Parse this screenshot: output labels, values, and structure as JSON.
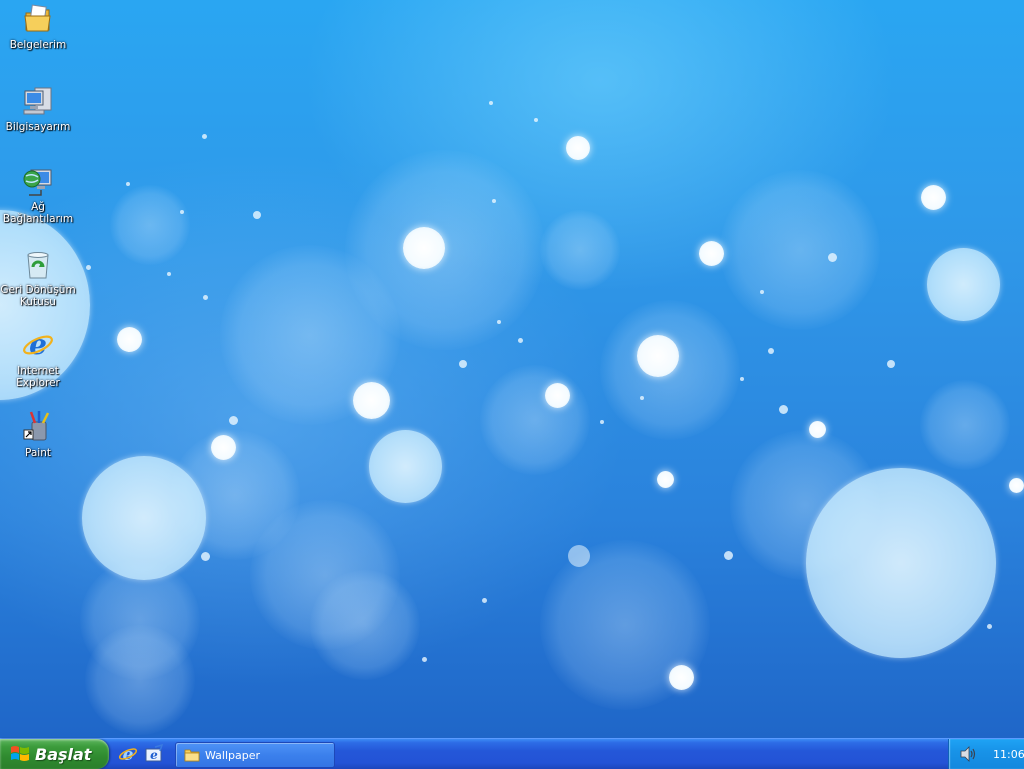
{
  "desktop": {
    "icons": [
      {
        "label": "Belgelerim",
        "icon": "my-documents-icon"
      },
      {
        "label": "Bilgisayarım",
        "icon": "my-computer-icon"
      },
      {
        "label": "Ağ Bağlantılarım",
        "icon": "network-connections-icon"
      },
      {
        "label": "Geri Dönüşüm Kutusu",
        "icon": "recycle-bin-icon"
      },
      {
        "label": "Internet Explorer",
        "icon": "internet-explorer-icon"
      },
      {
        "label": "Paint",
        "icon": "paint-icon"
      }
    ]
  },
  "taskbar": {
    "start_label": "Başlat",
    "quick_launch": [
      "internet-explorer-icon",
      "outlook-express-icon"
    ],
    "windows": [
      {
        "label": "Wallpaper",
        "icon": "folder-icon"
      }
    ],
    "clock": "11:06",
    "tray_icons": [
      "volume-icon"
    ]
  },
  "colors": {
    "taskbar_blue": "#2457d8",
    "start_green": "#3c9c3c",
    "tray_blue": "#1893e8",
    "wallpaper_blue": "#2f97e8"
  }
}
